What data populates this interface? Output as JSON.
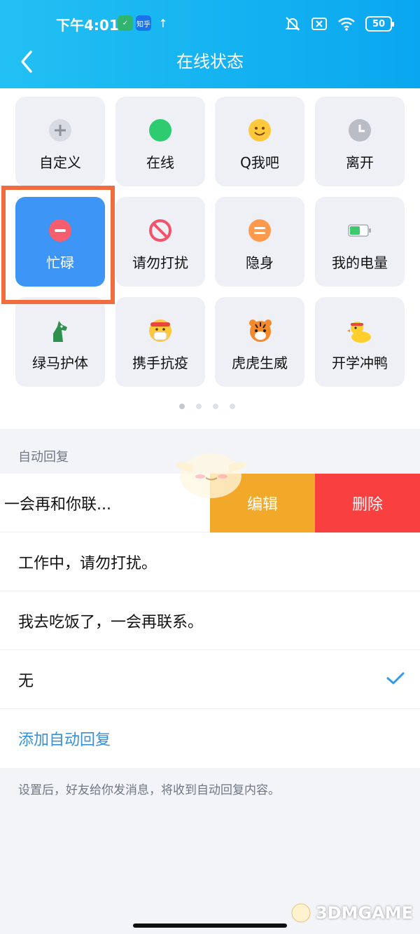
{
  "status_bar": {
    "time": "下午4:01",
    "app_badge": "知乎",
    "battery": "50"
  },
  "header": {
    "title": "在线状态"
  },
  "statuses": [
    {
      "label": "自定义",
      "icon": "plus-icon"
    },
    {
      "label": "在线",
      "icon": "online-dot-icon"
    },
    {
      "label": "Q我吧",
      "icon": "smile-icon"
    },
    {
      "label": "离开",
      "icon": "clock-icon"
    },
    {
      "label": "忙碌",
      "icon": "busy-minus-icon",
      "selected": true
    },
    {
      "label": "请勿打扰",
      "icon": "do-not-disturb-icon"
    },
    {
      "label": "隐身",
      "icon": "invisible-icon"
    },
    {
      "label": "我的电量",
      "icon": "battery-icon"
    },
    {
      "label": "绿马护体",
      "icon": "green-horse-icon"
    },
    {
      "label": "携手抗疫",
      "icon": "mask-face-icon"
    },
    {
      "label": "虎虎生威",
      "icon": "tiger-icon"
    },
    {
      "label": "开学冲鸭",
      "icon": "duck-icon"
    }
  ],
  "pager": {
    "pages": 4,
    "active": 1
  },
  "auto_reply": {
    "section_title": "自动回复",
    "swiped_item": {
      "text": "一会再和你联...",
      "edit_label": "编辑",
      "delete_label": "删除"
    },
    "items": [
      {
        "text": "工作中，请勿打扰。"
      },
      {
        "text": "我去吃饭了，一会再联系。"
      },
      {
        "text": "无",
        "checked": true
      }
    ],
    "add_label": "添加自动回复",
    "footnote": "设置后，好友给你发消息，将收到自动回复内容。"
  },
  "watermark": "3DMGAME",
  "colors": {
    "header": "#0aa7f0",
    "selected_tile": "#3d96f5",
    "edit": "#f2a92a",
    "delete": "#f94040",
    "highlight": "#f26d3d",
    "link": "#3490d8"
  }
}
